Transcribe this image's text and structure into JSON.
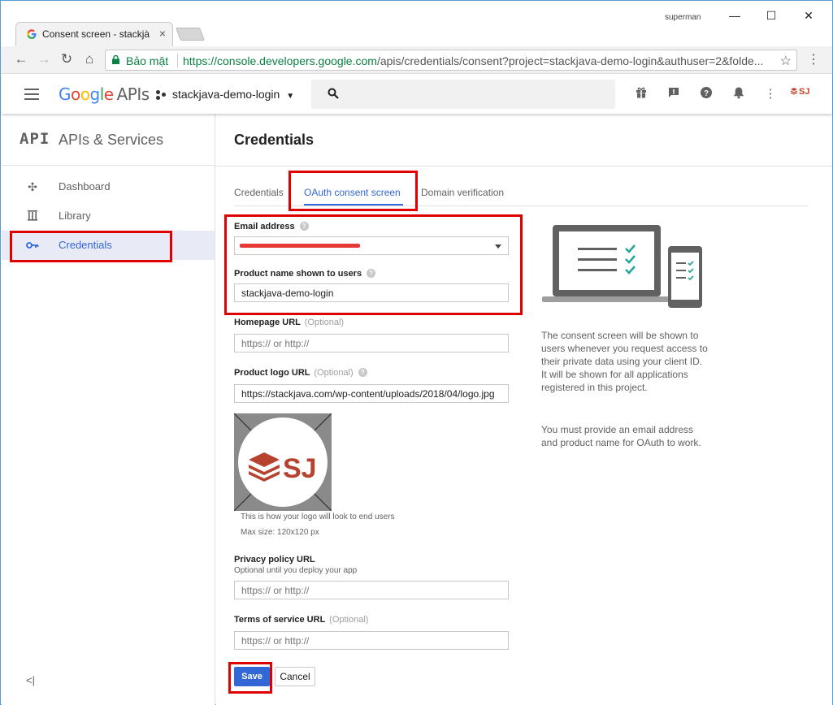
{
  "browser": {
    "tab_title": "Consent screen - stackjà",
    "window_user": "superman",
    "secure_label": "Bảo mật",
    "url_host": "https://console.developers.google.com",
    "url_path": "/apis/credentials/consent?project=stackjava-demo-login&authuser=2&folde..."
  },
  "header": {
    "logo_google": "Google",
    "logo_apis": "APIs",
    "project_name": "stackjava-demo-login",
    "avatar_text": "SJ"
  },
  "sidebar": {
    "api_mark": "API",
    "title": "APIs & Services",
    "items": [
      {
        "label": "Dashboard"
      },
      {
        "label": "Library"
      },
      {
        "label": "Credentials"
      }
    ],
    "collapse_label": "<|"
  },
  "main": {
    "page_title": "Credentials",
    "tabs": [
      {
        "label": "Credentials"
      },
      {
        "label": "OAuth consent screen"
      },
      {
        "label": "Domain verification"
      }
    ],
    "form": {
      "email_label": "Email address",
      "email_redacted_text": "",
      "product_name_label": "Product name shown to users",
      "product_name_value": "stackjava-demo-login",
      "homepage_label": "Homepage URL",
      "optional_text": "(Optional)",
      "homepage_placeholder": "https:// or http://",
      "logo_url_label": "Product logo URL",
      "logo_url_value": "https://stackjava.com/wp-content/uploads/2018/04/logo.jpg",
      "logo_preview": {
        "brand_text": "SJ"
      },
      "logo_hint": "This is how your logo will look to end users",
      "logo_max_size": "Max size: 120x120 px",
      "privacy_label": "Privacy policy URL",
      "privacy_hint": "Optional until you deploy your app",
      "privacy_placeholder": "https:// or http://",
      "tos_label": "Terms of service URL",
      "tos_placeholder": "https:// or http://",
      "save_label": "Save",
      "cancel_label": "Cancel"
    },
    "info_1": "The consent screen will be shown to users whenever you request access to their private data using your client ID. It will be shown for all applications registered in this project.",
    "info_2": "You must provide an email address and product name for OAuth to work."
  },
  "colors": {
    "accent": "#3367d6",
    "highlight_box": "#e00000",
    "check": "#26a69a"
  }
}
